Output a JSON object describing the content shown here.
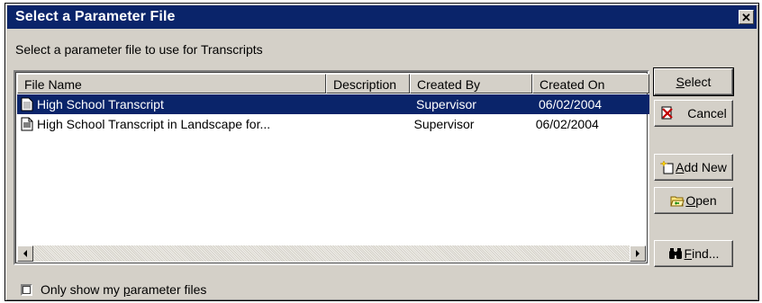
{
  "window": {
    "title": "Select a Parameter File",
    "close_glyph": "✕"
  },
  "prompt": "Select a parameter file to use for Transcripts",
  "list": {
    "columns": [
      {
        "label": "File Name"
      },
      {
        "label": "Description"
      },
      {
        "label": "Created By"
      },
      {
        "label": "Created On"
      }
    ],
    "rows": [
      {
        "name": "High School Transcript",
        "description": "",
        "created_by": "Supervisor",
        "created_on": "06/02/2004",
        "selected": true
      },
      {
        "name": "High School Transcript in Landscape for...",
        "description": "",
        "created_by": "Supervisor",
        "created_on": "06/02/2004",
        "selected": false
      }
    ]
  },
  "buttons": {
    "select": {
      "pre": "",
      "key": "S",
      "post": "elect",
      "icon": null
    },
    "cancel": {
      "pre": "Cancel",
      "key": "",
      "post": "",
      "icon": "cancel-icon"
    },
    "add_new": {
      "pre": "",
      "key": "A",
      "post": "dd New",
      "icon": "add-new-icon"
    },
    "open": {
      "pre": "",
      "key": "O",
      "post": "pen",
      "icon": "open-folder-icon"
    },
    "find": {
      "pre": "",
      "key": "F",
      "post": "ind...",
      "icon": "binoculars-icon"
    }
  },
  "checkbox": {
    "label_pre": "Only show my ",
    "label_key": "p",
    "label_post": "arameter files",
    "checked": false
  },
  "colors": {
    "title_bar": "#0a246a",
    "selection": "#0a246a",
    "face": "#d4d0c8"
  }
}
